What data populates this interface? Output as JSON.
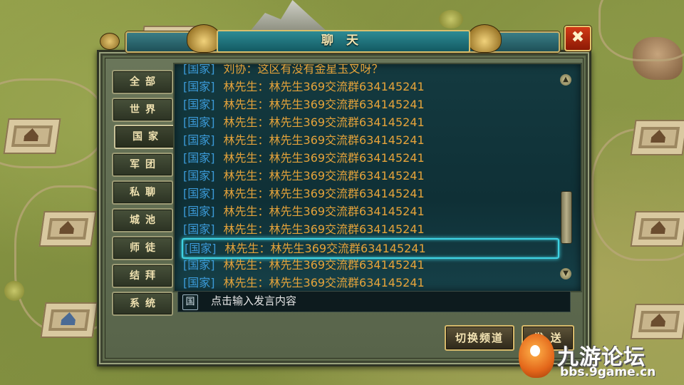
{
  "window": {
    "title": "聊 天",
    "close_icon": "✖"
  },
  "tabs": [
    {
      "label": "全部",
      "active": false
    },
    {
      "label": "世界",
      "active": false
    },
    {
      "label": "国家",
      "active": true
    },
    {
      "label": "军团",
      "active": false
    },
    {
      "label": "私聊",
      "active": false
    },
    {
      "label": "城池",
      "active": false
    },
    {
      "label": "师徒",
      "active": false
    },
    {
      "label": "结拜",
      "active": false
    },
    {
      "label": "系统",
      "active": false
    }
  ],
  "messages": [
    {
      "channel": "[国家]",
      "name": "刘协：",
      "text": "这区有没有金星玉叉呀？"
    },
    {
      "channel": "[国家]",
      "name": "林先生：",
      "text": "林先生369交流群634145241"
    },
    {
      "channel": "[国家]",
      "name": "林先生：",
      "text": "林先生369交流群634145241"
    },
    {
      "channel": "[国家]",
      "name": "林先生：",
      "text": "林先生369交流群634145241"
    },
    {
      "channel": "[国家]",
      "name": "林先生：",
      "text": "林先生369交流群634145241"
    },
    {
      "channel": "[国家]",
      "name": "林先生：",
      "text": "林先生369交流群634145241"
    },
    {
      "channel": "[国家]",
      "name": "林先生：",
      "text": "林先生369交流群634145241"
    },
    {
      "channel": "[国家]",
      "name": "林先生：",
      "text": "林先生369交流群634145241"
    },
    {
      "channel": "[国家]",
      "name": "林先生：",
      "text": "林先生369交流群634145241"
    },
    {
      "channel": "[国家]",
      "name": "林先生：",
      "text": "林先生369交流群634145241"
    },
    {
      "channel": "[国家]",
      "name": "林先生：",
      "text": "林先生369交流群634145241"
    },
    {
      "channel": "[国家]",
      "name": "林先生：",
      "text": "林先生369交流群634145241"
    },
    {
      "channel": "[国家]",
      "name": "林先生：",
      "text": "林先生369交流群634145241"
    }
  ],
  "highlighted_index": 10,
  "input": {
    "channel_badge": "国",
    "placeholder": "点击输入发言内容"
  },
  "buttons": {
    "switch_channel": "切换频道",
    "send": "发 送"
  },
  "watermark": {
    "name": "九游论坛",
    "url": "bbs.9game.cn"
  },
  "colors": {
    "channel": "#3b9ad8",
    "message": "#e5a33a",
    "highlight": "#3fd3e3"
  }
}
